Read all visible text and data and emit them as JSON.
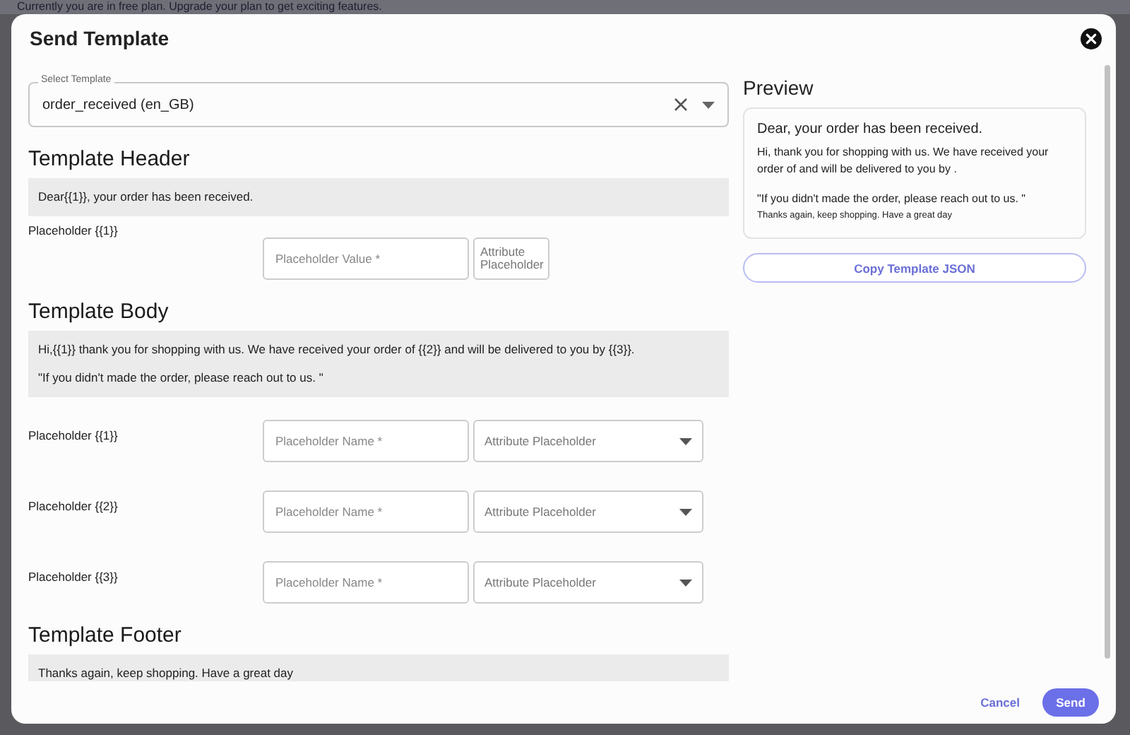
{
  "backdrop": {
    "banner": "Currently you are in free plan. Upgrade your plan to get exciting features."
  },
  "dialog": {
    "title": "Send Template"
  },
  "template_select": {
    "label": "Select Template",
    "value": "order_received (en_GB)"
  },
  "sections": [
    {
      "heading": "Template Header",
      "paragraphs": [
        "Dear{{1}}, your order has been received."
      ],
      "placeholders": [
        {
          "label": "Placeholder {{1}}",
          "kind": "compact",
          "field_placeholder": "Placeholder Value *",
          "attribute_placeholder": "Attribute Placeholder"
        }
      ]
    },
    {
      "heading": "Template Body",
      "paragraphs": [
        "Hi,{{1}} thank you for shopping with us. We have received your order of {{2}} and will be delivered to you by {{3}}.",
        "\"If you didn't made the order, please reach out to us. \""
      ],
      "placeholders": [
        {
          "label": "Placeholder {{1}}",
          "kind": "full",
          "field_placeholder": "Placeholder Name *",
          "attribute_placeholder": "Attribute Placeholder"
        },
        {
          "label": "Placeholder {{2}}",
          "kind": "full",
          "field_placeholder": "Placeholder Name *",
          "attribute_placeholder": "Attribute Placeholder"
        },
        {
          "label": "Placeholder {{3}}",
          "kind": "full",
          "field_placeholder": "Placeholder Name *",
          "attribute_placeholder": "Attribute Placeholder"
        }
      ]
    },
    {
      "heading": "Template Footer",
      "paragraphs": [
        "Thanks again, keep shopping. Have a great day"
      ]
    }
  ],
  "preview": {
    "title": "Preview",
    "header": "Dear, your order has been received.",
    "body": [
      "Hi, thank you for shopping with us. We have received your order of  and will be delivered to you by .",
      "\"If you didn't made the order, please reach out to us. \""
    ],
    "footer": "Thanks again, keep shopping. Have a great day",
    "copy_button": "Copy Template JSON"
  },
  "actions": {
    "cancel": "Cancel",
    "send": "Send"
  }
}
